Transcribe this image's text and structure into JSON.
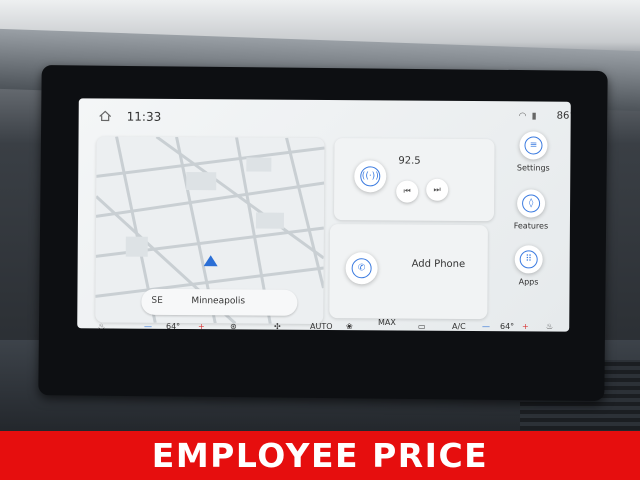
{
  "status_bar": {
    "time": "11:33",
    "outside_temp": "86°",
    "home_icon": "home-icon",
    "wifi_icon": "wifi-icon",
    "signal_icon": "signal-icon"
  },
  "map": {
    "compass": "SE",
    "city": "Minneapolis"
  },
  "radio": {
    "frequency": "92.5",
    "prev_icon": "skip-back-icon",
    "next_icon": "skip-forward-icon"
  },
  "phone": {
    "label": "Add Phone"
  },
  "side_menu": {
    "items": [
      {
        "label": "Settings"
      },
      {
        "label": "Features"
      },
      {
        "label": "Apps"
      }
    ]
  },
  "climate": {
    "driver_temp": "64°",
    "passenger_temp": "64°",
    "auto_label": "AUTO",
    "max_label": "MAX",
    "ac_label": "A/C"
  },
  "banner": {
    "text": "EMPLOYEE PRICE",
    "color": "#e60e0e"
  },
  "colors": {
    "accent": "#3b7be0",
    "nav_arrow": "#2b6fd6"
  }
}
